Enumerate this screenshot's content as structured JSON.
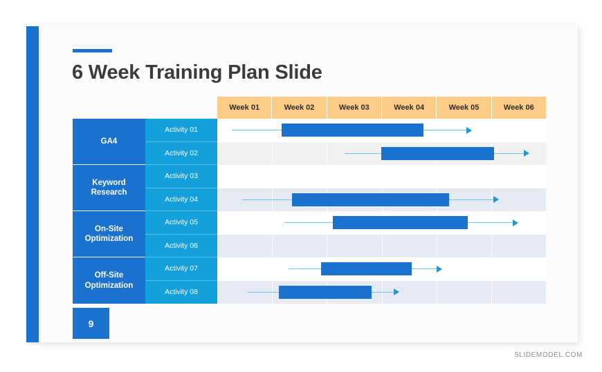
{
  "slide": {
    "title": "6 Week Training Plan Slide",
    "page_number": "9",
    "watermark": "SLIDEMODEL.COM",
    "accent_color": "#1b72ce",
    "header_color": "#fbcd87",
    "activity_color": "#13a0dd",
    "connector_color": "#6fc6e8"
  },
  "chart_data": {
    "type": "bar",
    "title": "6 Week Training Plan Slide",
    "xlabel": "",
    "ylabel": "",
    "columns": [
      "Week 01",
      "Week 02",
      "Week 03",
      "Week 04",
      "Week 05",
      "Week 06"
    ],
    "xlim": [
      0,
      6
    ],
    "grid": true,
    "legend": "none",
    "categories": [
      {
        "label": "GA4",
        "rows": 2
      },
      {
        "label": "Keyword\nResearch",
        "rows": 2
      },
      {
        "label": "On-Site\nOptimization",
        "rows": 2
      },
      {
        "label": "Off-Site\nOptimization",
        "rows": 2
      }
    ],
    "category_labels": [
      "GA4",
      "Keyword Research",
      "On-Site Optimization",
      "Off-Site Optimization"
    ],
    "rows": [
      {
        "activity": "Activity 01",
        "group": "GA4",
        "line_start": 0.26,
        "bar_start": 1.18,
        "bar_end": 3.76,
        "arrow_end": 4.55,
        "band": "white"
      },
      {
        "activity": "Activity 02",
        "group": "GA4",
        "line_start": 2.33,
        "bar_start": 2.99,
        "bar_end": 5.05,
        "arrow_end": 5.6,
        "band": "gray"
      },
      {
        "activity": "Activity 03",
        "group": "Keyword Research",
        "line_start": null,
        "bar_start": null,
        "bar_end": null,
        "arrow_end": null,
        "band": "white"
      },
      {
        "activity": "Activity 04",
        "group": "Keyword Research",
        "line_start": 0.45,
        "bar_start": 1.37,
        "bar_end": 4.23,
        "arrow_end": 5.04,
        "band": "lavender"
      },
      {
        "activity": "Activity 05",
        "group": "On-Site Optimization",
        "line_start": 1.22,
        "bar_start": 2.11,
        "bar_end": 4.57,
        "arrow_end": 5.39,
        "band": "white"
      },
      {
        "activity": "Activity 06",
        "group": "On-Site Optimization",
        "line_start": null,
        "bar_start": null,
        "bar_end": null,
        "arrow_end": null,
        "band": "lavender"
      },
      {
        "activity": "Activity 07",
        "group": "Off-Site Optimization",
        "line_start": 1.31,
        "bar_start": 1.9,
        "bar_end": 3.55,
        "arrow_end": 4.0,
        "band": "white"
      },
      {
        "activity": "Activity 08",
        "group": "Off-Site Optimization",
        "line_start": 0.56,
        "bar_start": 1.12,
        "bar_end": 2.82,
        "arrow_end": 3.22,
        "band": "lavender"
      }
    ],
    "band_colors": {
      "white": "#ffffff",
      "gray": "#f1f1f1",
      "lavender": "#e6eaf5"
    },
    "bar_color": "#1b72ce"
  }
}
